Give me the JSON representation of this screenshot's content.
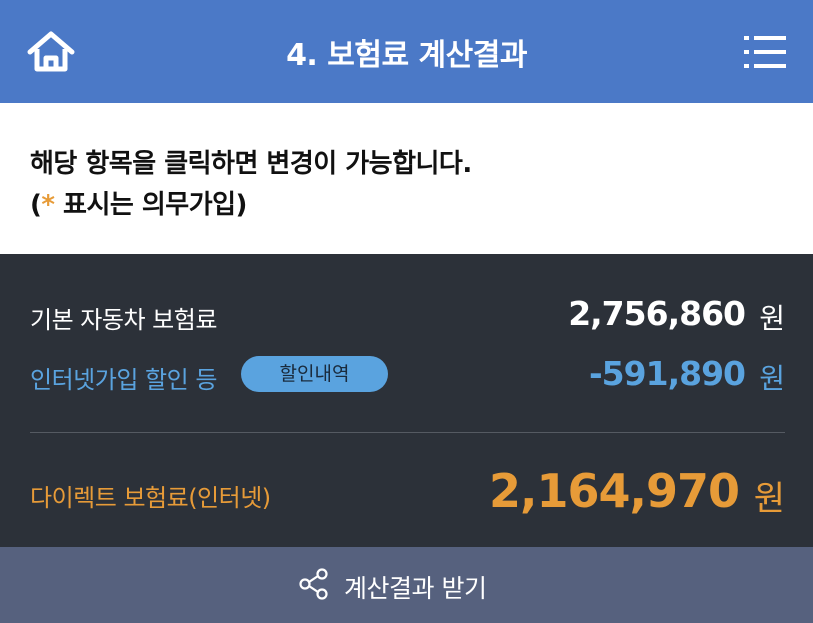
{
  "header": {
    "title": "4. 보험료 계산결과",
    "home_icon": "home-icon",
    "menu_icon": "menu-icon"
  },
  "notice": {
    "line1": "해당 항목을 클릭하면 변경이 가능합니다.",
    "line2_prefix": "(",
    "star": "*",
    "line2_suffix": " 표시는 의무가입)"
  },
  "result": {
    "base": {
      "label": "기본 자동차 보험료",
      "amount": "2,756,860",
      "unit": "원"
    },
    "discount": {
      "label": "인터넷가입 할인 등",
      "button": "할인내역",
      "amount": "-591,890",
      "unit": "원"
    },
    "total": {
      "label": "다이렉트 보험료(인터넷)",
      "amount": "2,164,970",
      "unit": "원"
    }
  },
  "footer": {
    "label": "계산결과 받기",
    "icon": "share-icon"
  },
  "colors": {
    "header_bg": "#4b79c7",
    "result_bg": "#2c3139",
    "discount_blue": "#5aa3df",
    "total_orange": "#e79b38",
    "footer_bg": "#56617e"
  }
}
